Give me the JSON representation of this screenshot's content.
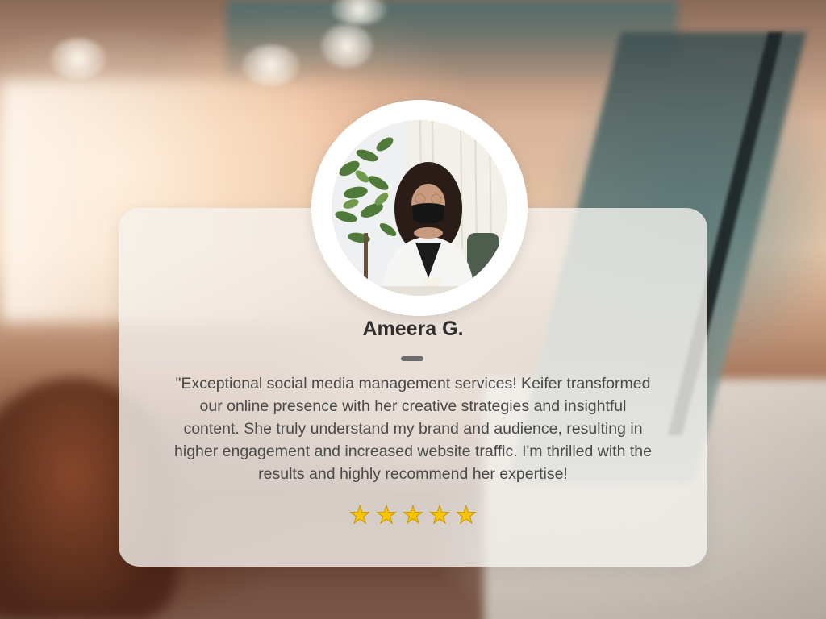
{
  "testimonial": {
    "name": "Ameera G.",
    "quote": "\"Exceptional social media management services! Keifer transformed our online presence with her creative strategies and insightful content. She truly understand my brand and audience, resulting in higher engagement and increased website traffic. I'm thrilled with the results and highly recommend her expertise!",
    "rating": 5,
    "rating_max": 5,
    "star_glyph": "★",
    "star_color": "#f7c600"
  },
  "colors": {
    "card_background": "#f4f1ee",
    "name_text": "#2f2f2f",
    "body_text": "#4a4a4a",
    "divider": "#6b6b6b"
  },
  "icons": {
    "avatar": "profile-photo",
    "rating": "star-icon"
  }
}
